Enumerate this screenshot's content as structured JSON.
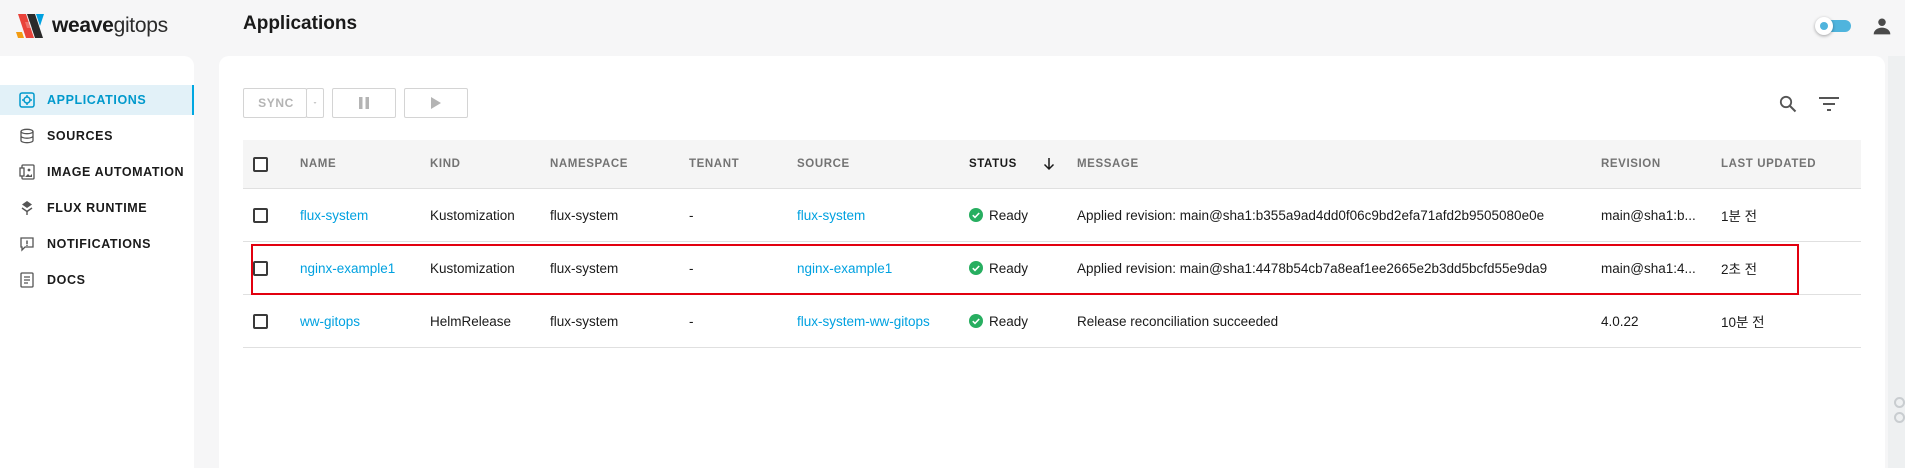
{
  "app": {
    "logo_bold": "weave",
    "logo_light": "gitops",
    "page_title": "Applications"
  },
  "sidebar": {
    "items": [
      {
        "label": "APPLICATIONS",
        "icon": "applications-icon",
        "active": true
      },
      {
        "label": "SOURCES",
        "icon": "sources-icon",
        "active": false
      },
      {
        "label": "IMAGE AUTOMATION",
        "icon": "image-automation-icon",
        "active": false
      },
      {
        "label": "FLUX RUNTIME",
        "icon": "flux-runtime-icon",
        "active": false
      },
      {
        "label": "NOTIFICATIONS",
        "icon": "notifications-icon",
        "active": false
      },
      {
        "label": "DOCS",
        "icon": "docs-icon",
        "active": false
      }
    ]
  },
  "toolbar": {
    "sync_label": "SYNC"
  },
  "table": {
    "columns": [
      "NAME",
      "KIND",
      "NAMESPACE",
      "TENANT",
      "SOURCE",
      "STATUS",
      "MESSAGE",
      "REVISION",
      "LAST UPDATED"
    ],
    "sorted_column": "STATUS",
    "rows": [
      {
        "name": "flux-system",
        "kind": "Kustomization",
        "namespace": "flux-system",
        "tenant": "-",
        "source": "flux-system",
        "status": "Ready",
        "message": "Applied revision: main@sha1:b355a9ad4dd0f06c9bd2efa71afd2b9505080e0e",
        "revision": "main@sha1:b...",
        "updated": "1분 전"
      },
      {
        "name": "nginx-example1",
        "kind": "Kustomization",
        "namespace": "flux-system",
        "tenant": "-",
        "source": "nginx-example1",
        "status": "Ready",
        "message": "Applied revision: main@sha1:4478b54cb7a8eaf1ee2665e2b3dd5bcfd55e9da9",
        "revision": "main@sha1:4...",
        "updated": "2초 전"
      },
      {
        "name": "ww-gitops",
        "kind": "HelmRelease",
        "namespace": "flux-system",
        "tenant": "-",
        "source": "flux-system-ww-gitops",
        "status": "Ready",
        "message": "Release reconciliation succeeded",
        "revision": "4.0.22",
        "updated": "10분 전"
      }
    ]
  },
  "colors": {
    "accent": "#00a1e0",
    "ready": "#27ae60",
    "highlight": "#e2000f"
  }
}
